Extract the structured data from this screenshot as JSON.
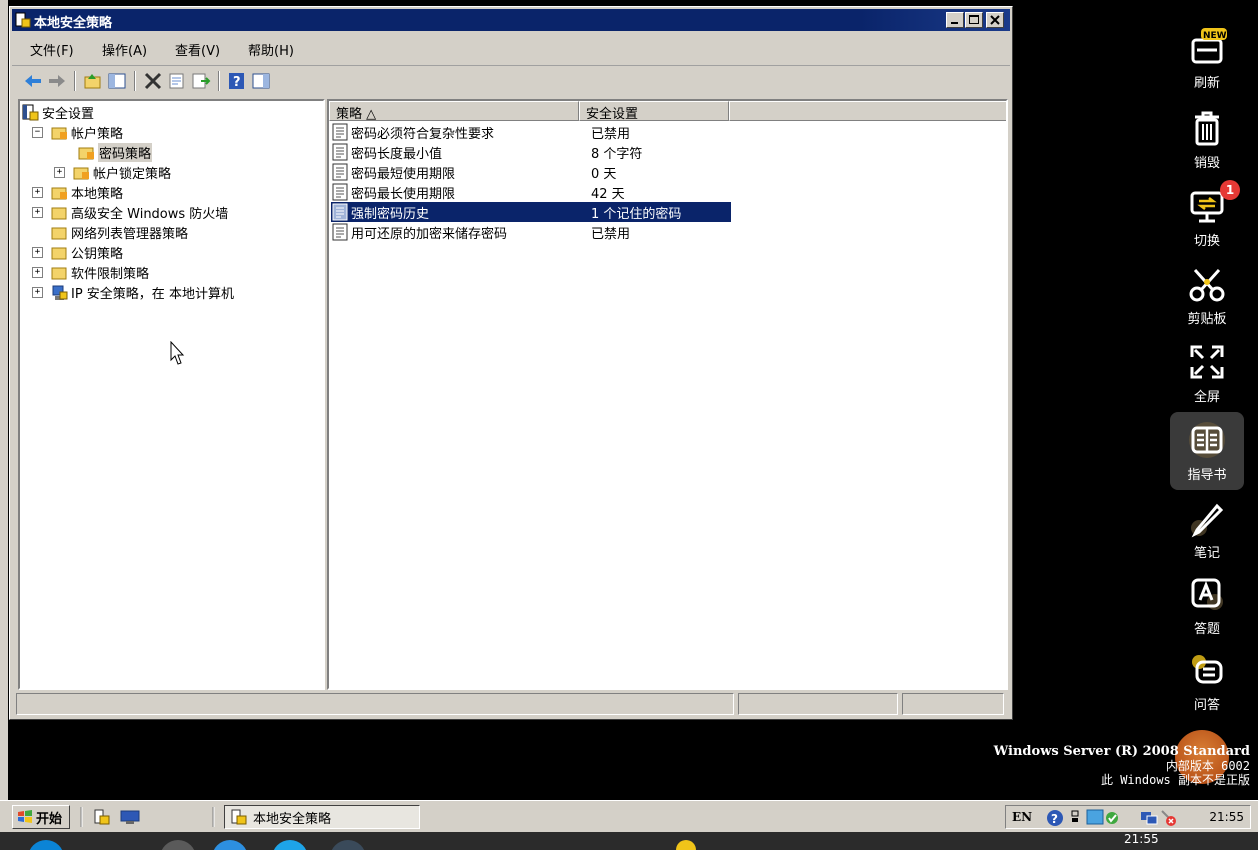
{
  "window": {
    "title": "本地安全策略",
    "menus": [
      "文件(F)",
      "操作(A)",
      "查看(V)",
      "帮助(H)"
    ]
  },
  "tree": {
    "root": "安全设置",
    "items": [
      {
        "label": "帐户策略",
        "expander": "−"
      },
      {
        "label": "密码策略",
        "expander": ""
      },
      {
        "label": "帐户锁定策略",
        "expander": "+"
      },
      {
        "label": "本地策略",
        "expander": "+"
      },
      {
        "label": "高级安全 Windows 防火墙",
        "expander": "+"
      },
      {
        "label": "网络列表管理器策略",
        "expander": ""
      },
      {
        "label": "公钥策略",
        "expander": "+"
      },
      {
        "label": "软件限制策略",
        "expander": "+"
      },
      {
        "label": "IP 安全策略，在 本地计算机",
        "expander": "+"
      }
    ]
  },
  "list": {
    "columns": [
      "策略 △",
      "安全设置"
    ],
    "rows": [
      {
        "name": "密码必须符合复杂性要求",
        "value": "已禁用"
      },
      {
        "name": "密码长度最小值",
        "value": "8 个字符"
      },
      {
        "name": "密码最短使用期限",
        "value": "0 天"
      },
      {
        "name": "密码最长使用期限",
        "value": "42 天"
      },
      {
        "name": "强制密码历史",
        "value": "1 个记住的密码"
      },
      {
        "name": "用可还原的加密来储存密码",
        "value": "已禁用"
      }
    ],
    "selected_index": 4
  },
  "sidebar": {
    "items": [
      {
        "label": "刷新",
        "icon": "new-icon"
      },
      {
        "label": "销毁",
        "icon": "trash-icon"
      },
      {
        "label": "切换",
        "icon": "switch-icon",
        "badge": "1"
      },
      {
        "label": "剪贴板",
        "icon": "scissors-icon"
      },
      {
        "label": "全屏",
        "icon": "fullscreen-icon"
      },
      {
        "label": "指导书",
        "icon": "book-icon"
      },
      {
        "label": "笔记",
        "icon": "pen-icon"
      },
      {
        "label": "答题",
        "icon": "answer-icon"
      },
      {
        "label": "问答",
        "icon": "qa-icon"
      }
    ],
    "new_badge": "NEW"
  },
  "watermark": {
    "line1": "Windows Server (R) 2008 Standard",
    "line2": "内部版本 6002",
    "line3": "此 Windows 副本不是正版"
  },
  "taskbar": {
    "start": "开始",
    "task": "本地安全策略",
    "lang": "EN",
    "clock": "21:55"
  },
  "host": {
    "clock": "21:55"
  },
  "colors": {
    "titlebar": "#0a246a",
    "selection": "#0a246a",
    "chrome": "#d4d0c8"
  }
}
